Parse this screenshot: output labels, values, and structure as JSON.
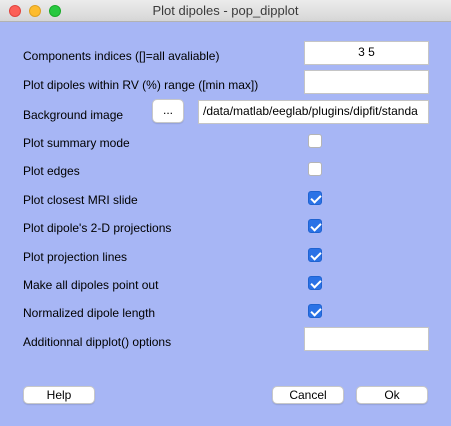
{
  "window": {
    "title": "Plot dipoles - pop_dipplot"
  },
  "fields": {
    "components": {
      "label": "Components indices ([]=all avaliable)",
      "value": "3 5"
    },
    "rv_range": {
      "label": "Plot dipoles within RV (%) range ([min max])",
      "value": ""
    },
    "background": {
      "label": "Background image",
      "browse_label": "...",
      "value": "/data/matlab/eeglab/plugins/dipfit/standa"
    },
    "options": {
      "label": "Additionnal dipplot() options",
      "value": ""
    }
  },
  "checkboxes": [
    {
      "label": "Plot summary mode",
      "checked": false
    },
    {
      "label": "Plot edges",
      "checked": false
    },
    {
      "label": "Plot closest MRI slide",
      "checked": true
    },
    {
      "label": "Plot dipole's 2-D projections",
      "checked": true
    },
    {
      "label": "Plot projection lines",
      "checked": true
    },
    {
      "label": "Make all dipoles point out",
      "checked": true
    },
    {
      "label": "Normalized dipole length",
      "checked": true
    }
  ],
  "buttons": {
    "help": "Help",
    "cancel": "Cancel",
    "ok": "Ok"
  },
  "colors": {
    "background": "#a7b6f5",
    "checkbox_checked": "#2a72e6"
  }
}
